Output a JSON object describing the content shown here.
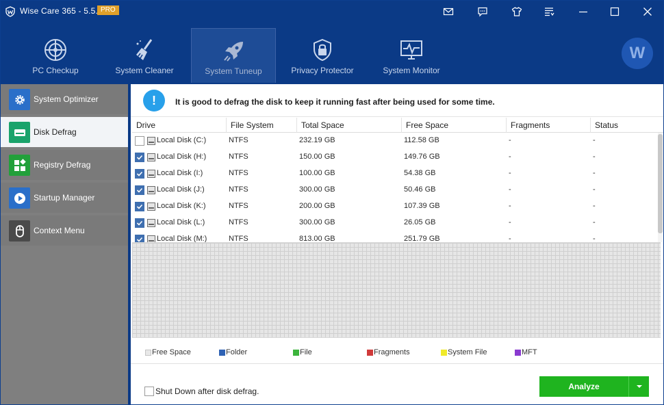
{
  "window": {
    "title": "Wise Care 365 - 5.5.1",
    "badge": "PRO",
    "avatar_letter": "W"
  },
  "titlebar_icons": [
    "mail-icon",
    "chat-icon",
    "tshirt-icon",
    "menu-icon",
    "minimize-icon",
    "maximize-icon",
    "close-icon"
  ],
  "nav": {
    "tabs": [
      {
        "label": "PC Checkup",
        "icon": "radar-icon"
      },
      {
        "label": "System Cleaner",
        "icon": "broom-icon"
      },
      {
        "label": "System Tuneup",
        "icon": "rocket-icon",
        "active": true
      },
      {
        "label": "Privacy Protector",
        "icon": "lock-shield-icon"
      },
      {
        "label": "System Monitor",
        "icon": "monitor-pulse-icon"
      }
    ]
  },
  "sidebar": {
    "items": [
      {
        "label": "System Optimizer",
        "icon": "gear-icon",
        "color": "#2a6fc9"
      },
      {
        "label": "Disk Defrag",
        "icon": "disk-icon",
        "color": "#1aa36b",
        "active": true
      },
      {
        "label": "Registry Defrag",
        "icon": "blocks-icon",
        "color": "#22a03a"
      },
      {
        "label": "Startup Manager",
        "icon": "play-icon",
        "color": "#2a6fc9"
      },
      {
        "label": "Context Menu",
        "icon": "mouse-icon",
        "color": "#4a4a4a"
      }
    ]
  },
  "info": {
    "message": "It is good to defrag the disk to keep it running fast after being used for some time."
  },
  "table": {
    "columns": [
      "Drive",
      "File System",
      "Total Space",
      "Free Space",
      "Fragments",
      "Status"
    ],
    "rows": [
      {
        "checked": false,
        "drive": "Local Disk (C:)",
        "fs": "NTFS",
        "total": "232.19 GB",
        "free": "112.58 GB",
        "fragments": "-",
        "status": "-"
      },
      {
        "checked": true,
        "drive": "Local Disk (H:)",
        "fs": "NTFS",
        "total": "150.00 GB",
        "free": "149.76 GB",
        "fragments": "-",
        "status": "-"
      },
      {
        "checked": true,
        "drive": "Local Disk (I:)",
        "fs": "NTFS",
        "total": "100.00 GB",
        "free": "54.38 GB",
        "fragments": "-",
        "status": "-"
      },
      {
        "checked": true,
        "drive": "Local Disk (J:)",
        "fs": "NTFS",
        "total": "300.00 GB",
        "free": "50.46 GB",
        "fragments": "-",
        "status": "-"
      },
      {
        "checked": true,
        "drive": "Local Disk (K:)",
        "fs": "NTFS",
        "total": "200.00 GB",
        "free": "107.39 GB",
        "fragments": "-",
        "status": "-"
      },
      {
        "checked": true,
        "drive": "Local Disk (L:)",
        "fs": "NTFS",
        "total": "300.00 GB",
        "free": "26.05 GB",
        "fragments": "-",
        "status": "-"
      },
      {
        "checked": true,
        "drive": "Local Disk (M:)",
        "fs": "NTFS",
        "total": "813.00 GB",
        "free": "251.79 GB",
        "fragments": "-",
        "status": "-"
      }
    ]
  },
  "legend": [
    {
      "label": "Free Space",
      "color": "#e8e8e8"
    },
    {
      "label": "Folder",
      "color": "#2f62b4"
    },
    {
      "label": "File",
      "color": "#3cb43c"
    },
    {
      "label": "Fragments",
      "color": "#d03a3a"
    },
    {
      "label": "System File",
      "color": "#f0ea2a"
    },
    {
      "label": "MFT",
      "color": "#8a3ad0"
    }
  ],
  "footer": {
    "shutdown_label": "Shut Down after disk defrag.",
    "analyze_label": "Analyze"
  }
}
